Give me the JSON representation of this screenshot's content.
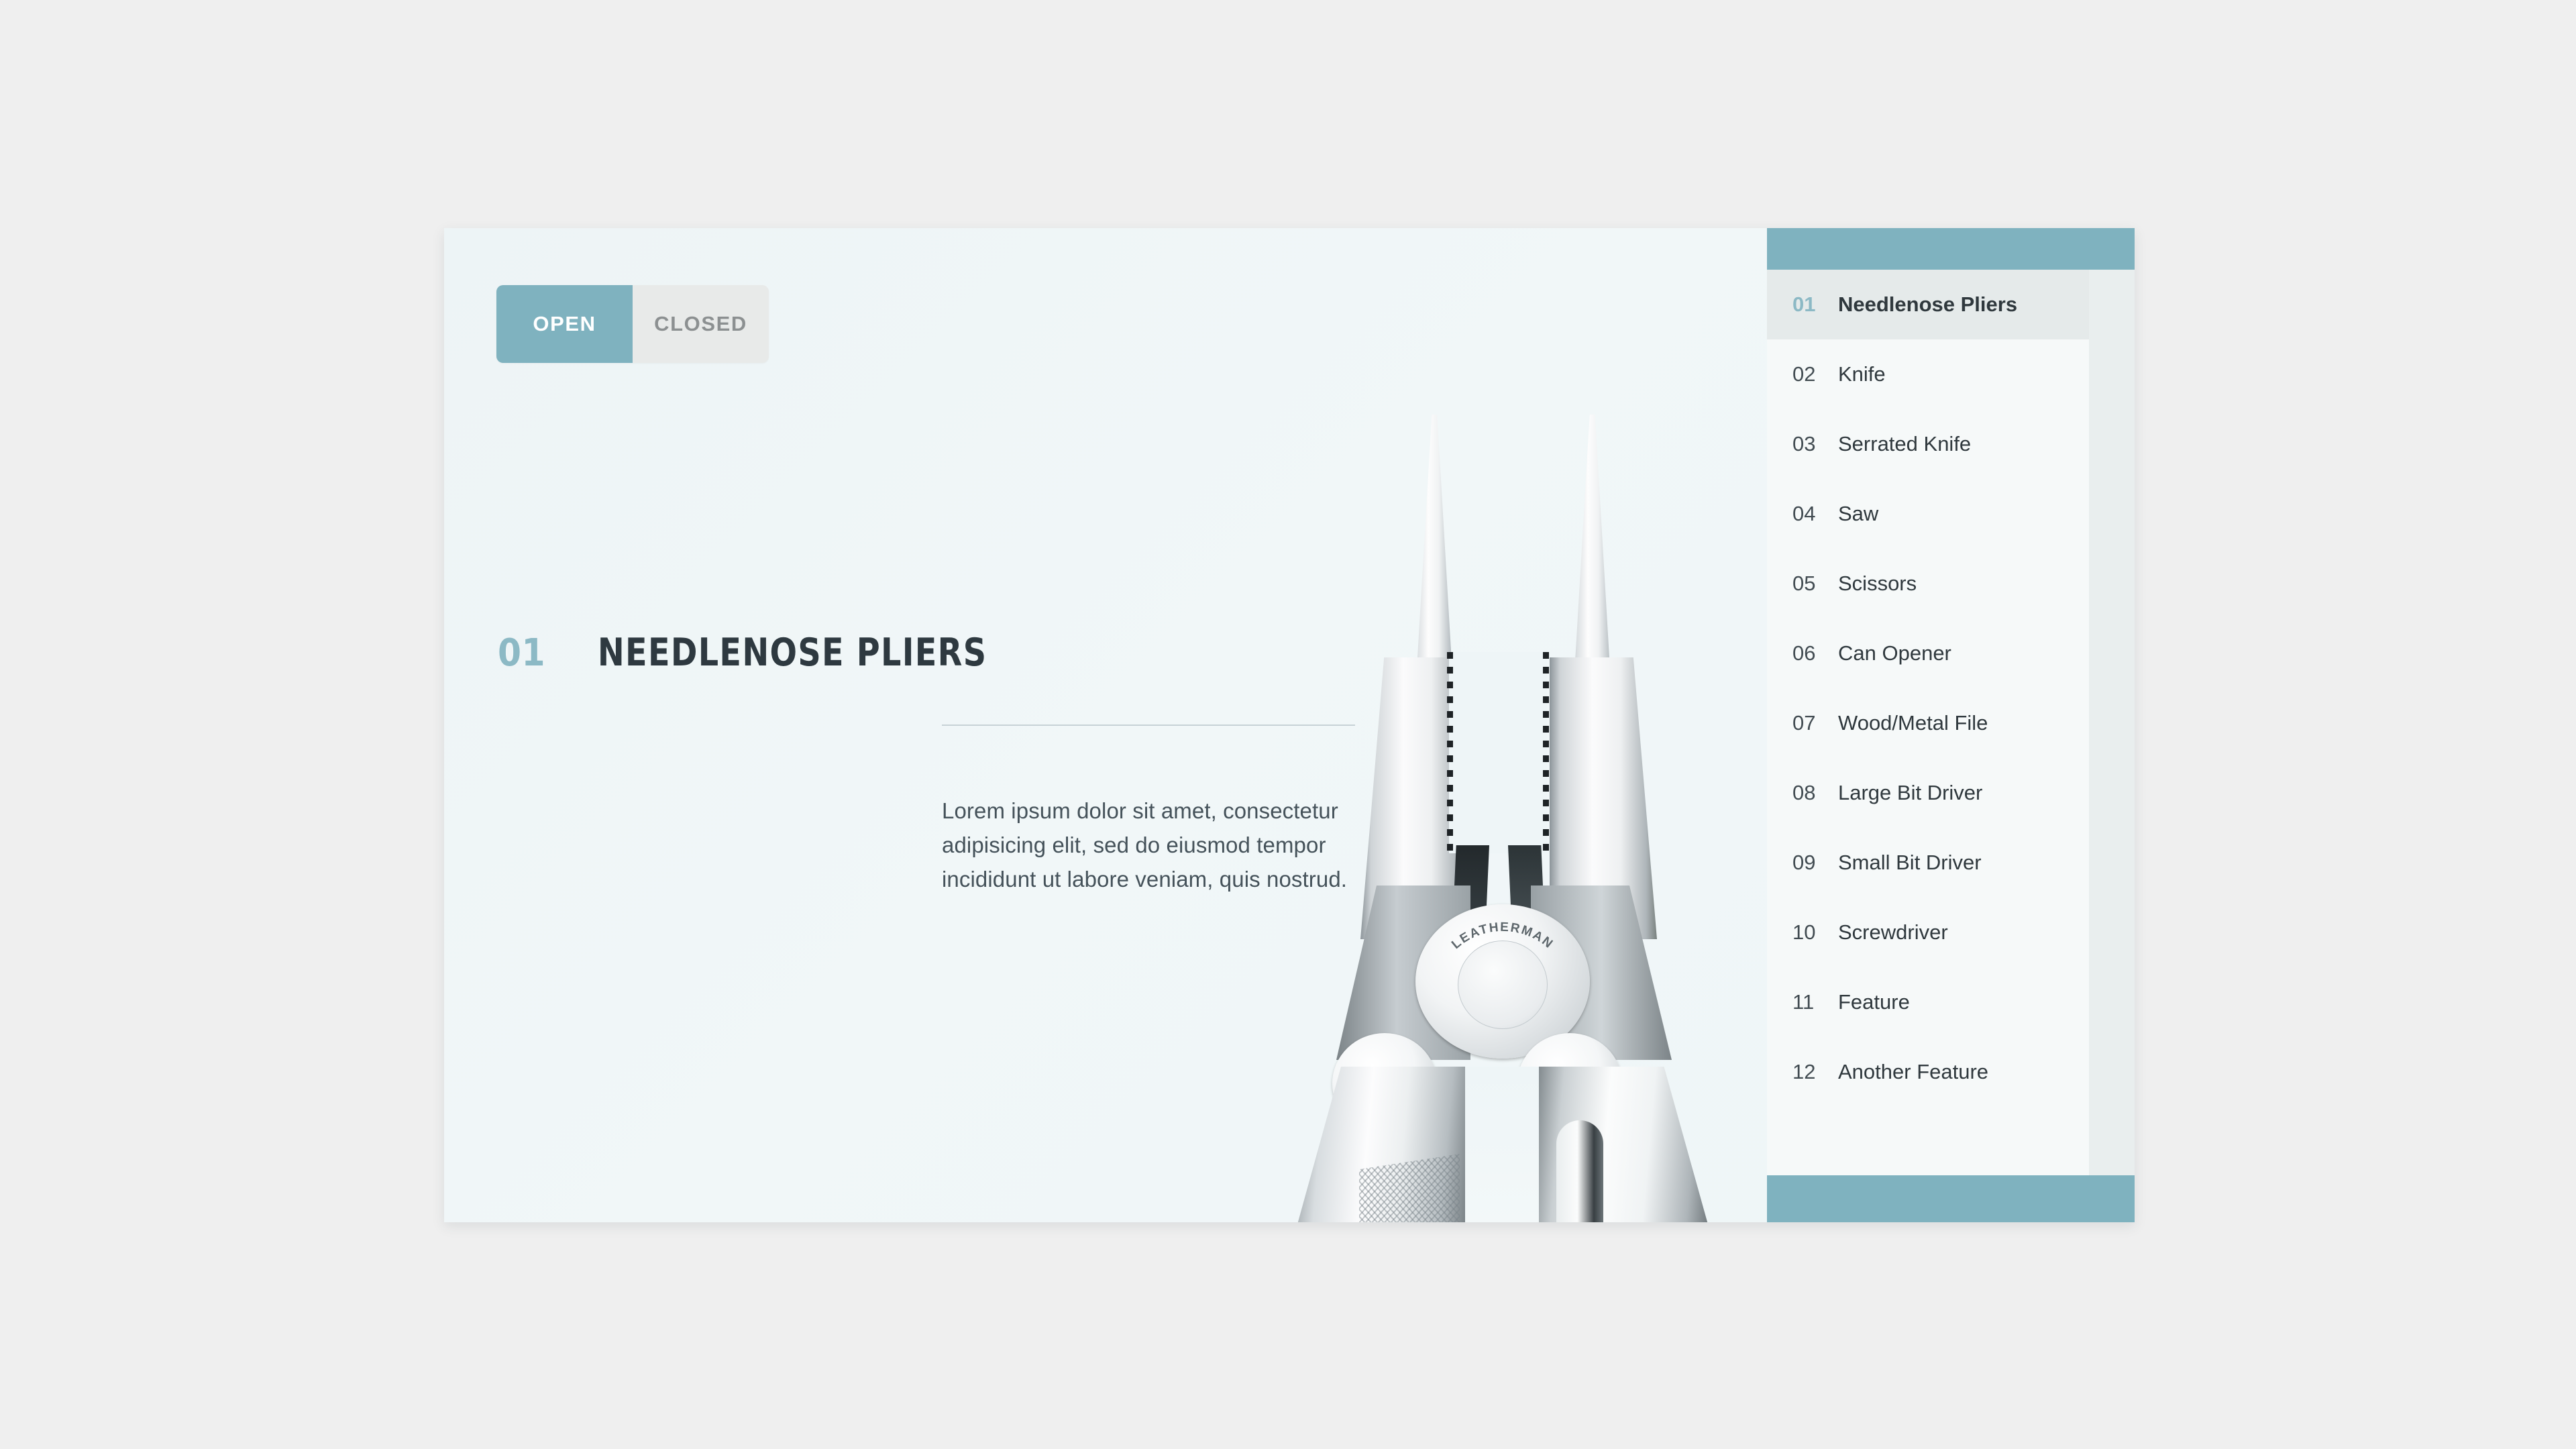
{
  "theme": {
    "page_background": "#efefef",
    "card_background": "#eef5f7",
    "accent_teal": "#7fb2bf",
    "accent_teal_light": "#8cb9c5",
    "text_dark": "#2e3940",
    "text_body": "#45525a",
    "toggle_inactive_bg": "#e8eae9",
    "toggle_inactive_text": "#8c9091",
    "selected_row_bg": "#e5eaea",
    "list_bg": "#f6f9f9",
    "divider": "#c7d2d6"
  },
  "toggle": {
    "options": [
      {
        "label": "OPEN",
        "state": "active"
      },
      {
        "label": "CLOSED",
        "state": "inactive"
      }
    ]
  },
  "headline": {
    "number": "01",
    "title": "NEEDLENOSE PLIERS"
  },
  "body": {
    "paragraph": "Lorem ipsum dolor sit amet, consectetur adipisicing elit, sed do eiusmod tempor incididunt ut labore veniam, quis nostrud."
  },
  "product_image": {
    "alt": "Leatherman multi-tool needlenose pliers, open",
    "brand_engraving": "LEATHERMAN"
  },
  "sidebar": {
    "selected_index": 0,
    "items": [
      {
        "num": "01",
        "label": "Needlenose Pliers"
      },
      {
        "num": "02",
        "label": "Knife"
      },
      {
        "num": "03",
        "label": "Serrated Knife"
      },
      {
        "num": "04",
        "label": "Saw"
      },
      {
        "num": "05",
        "label": "Scissors"
      },
      {
        "num": "06",
        "label": "Can Opener"
      },
      {
        "num": "07",
        "label": "Wood/Metal File"
      },
      {
        "num": "08",
        "label": "Large Bit Driver"
      },
      {
        "num": "09",
        "label": "Small Bit Driver"
      },
      {
        "num": "10",
        "label": "Screwdriver"
      },
      {
        "num": "11",
        "label": "Feature"
      },
      {
        "num": "12",
        "label": "Another Feature"
      }
    ]
  }
}
